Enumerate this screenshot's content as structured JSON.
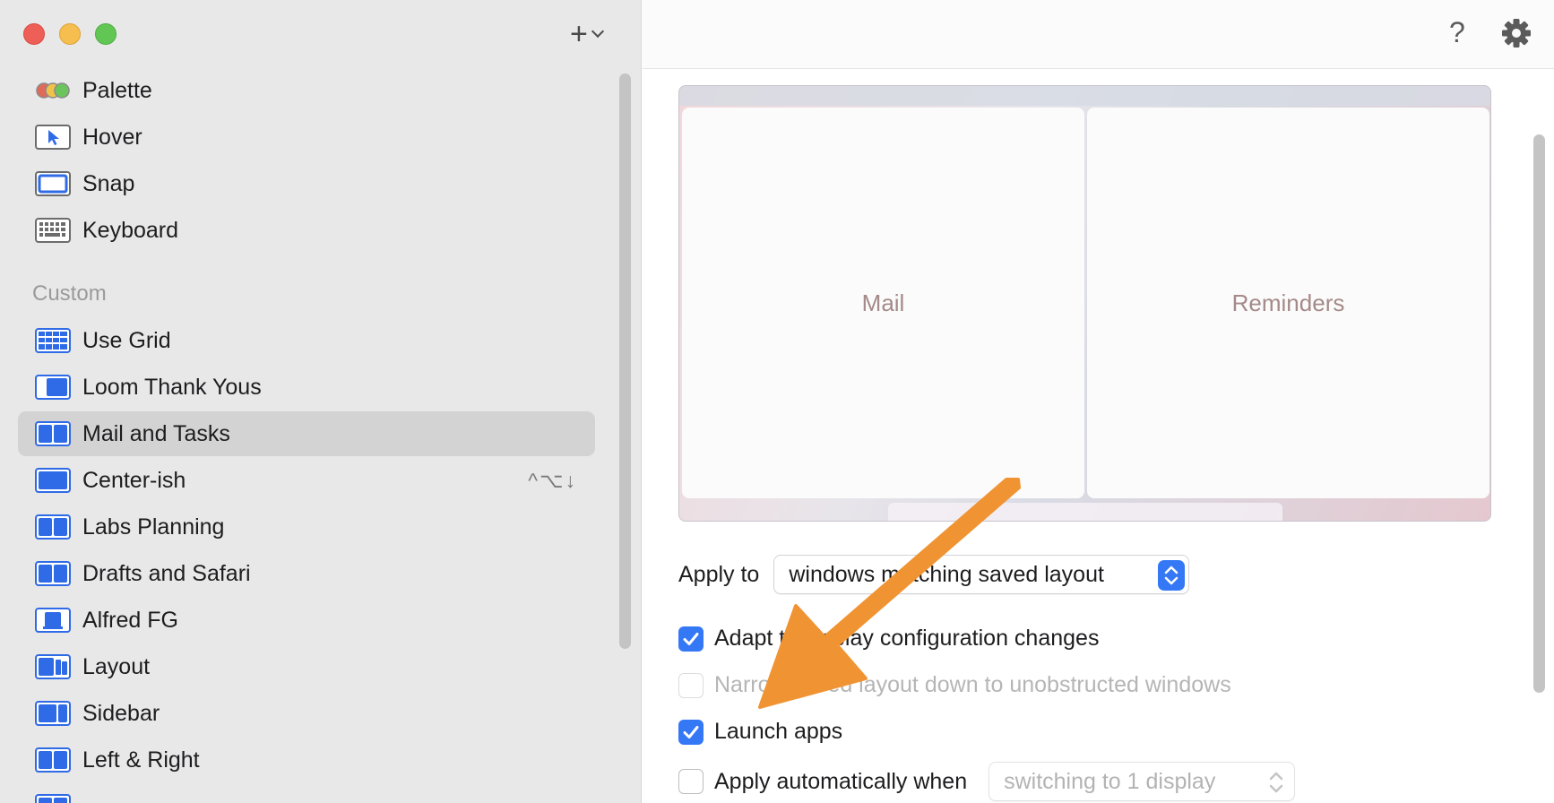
{
  "sidebar": {
    "add_button": "+",
    "section_header": "Custom",
    "builtin_items": [
      {
        "label": "Palette"
      },
      {
        "label": "Hover"
      },
      {
        "label": "Snap"
      },
      {
        "label": "Keyboard"
      }
    ],
    "custom_items": [
      {
        "label": "Use Grid"
      },
      {
        "label": "Loom Thank Yous"
      },
      {
        "label": "Mail and Tasks",
        "selected": true
      },
      {
        "label": "Center-ish",
        "shortcut": "^⌥↓"
      },
      {
        "label": "Labs Planning"
      },
      {
        "label": "Drafts and Safari"
      },
      {
        "label": "Alfred FG"
      },
      {
        "label": "Layout"
      },
      {
        "label": "Sidebar"
      },
      {
        "label": "Left & Right"
      }
    ]
  },
  "toolbar": {
    "help_label": "?"
  },
  "preview": {
    "left_pane": "Mail",
    "right_pane": "Reminders"
  },
  "settings": {
    "apply_to_label": "Apply to",
    "apply_to_value": "windows matching saved layout",
    "adapt_label": "Adapt to display configuration changes",
    "adapt_checked": true,
    "narrow_label": "Narrow saved layout down to unobstructed windows",
    "narrow_checked": false,
    "launch_label": "Launch apps",
    "launch_checked": true,
    "auto_label": "Apply automatically when",
    "auto_checked": false,
    "auto_value": "switching to 1 display"
  },
  "colors": {
    "accent": "#3478f6",
    "annotation_arrow": "#f09433"
  }
}
